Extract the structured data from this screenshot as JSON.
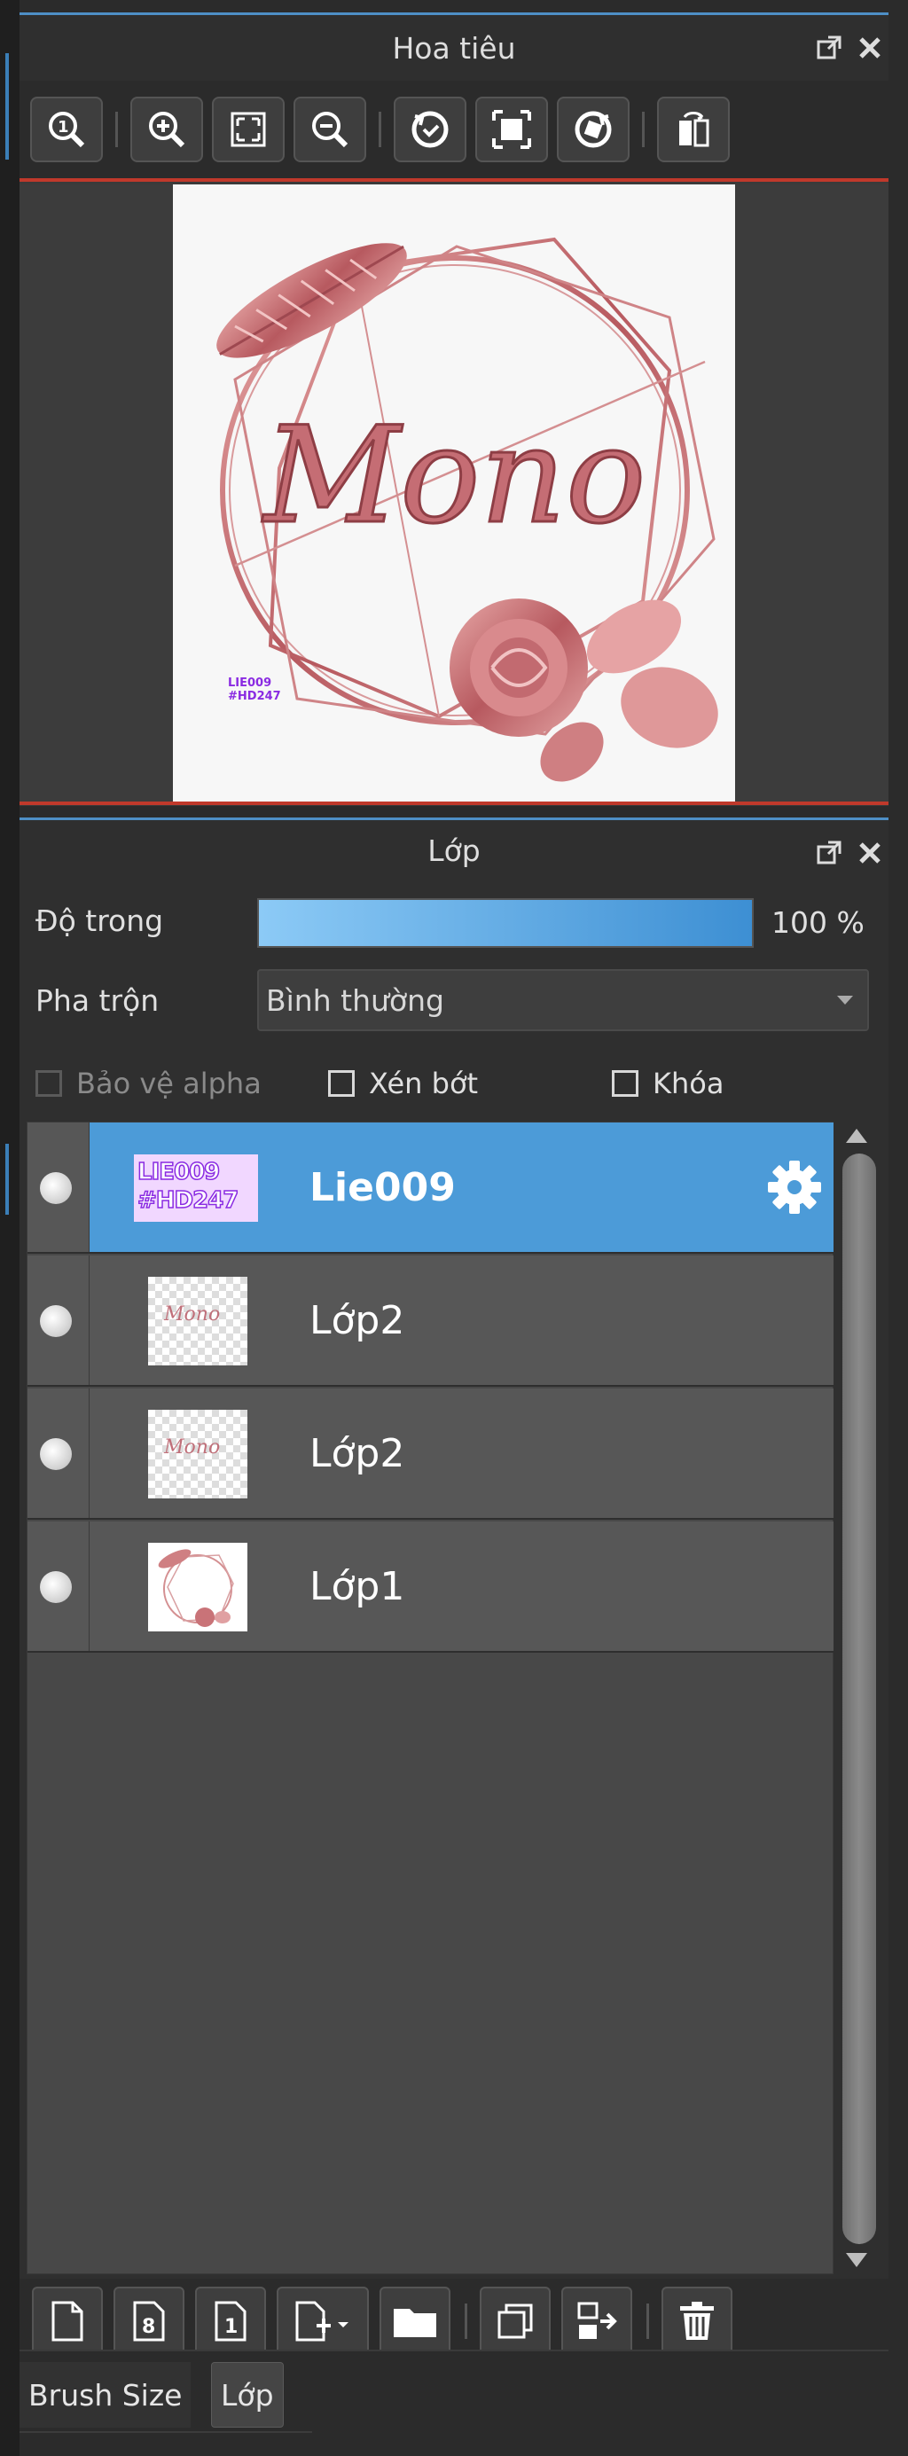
{
  "navigator": {
    "title": "Hoa tiêu",
    "toolbar": [
      "zoom-actual-icon",
      "zoom-in-icon",
      "fit-screen-icon",
      "zoom-out-icon",
      "rotate-left-icon",
      "fullscreen-icon",
      "rotate-right-icon",
      "flip-horizontal-icon"
    ],
    "preview": {
      "logo_text": "Mono",
      "watermark_line1": "LIE009",
      "watermark_line2": "#HD247"
    }
  },
  "layers_panel": {
    "title": "Lớp",
    "opacity_label": "Độ trong",
    "opacity_value": "100 %",
    "opacity_fraction": 1.0,
    "blend_label": "Pha trộn",
    "blend_value": "Bình thường",
    "protect_alpha_label": "Bảo vệ alpha",
    "clipping_label": "Xén bớt",
    "lock_label": "Khóa",
    "layers": [
      {
        "name": "Lie009",
        "thumb_text_1": "LIE009",
        "thumb_text_2": "#HD247",
        "selected": true
      },
      {
        "name": "Lớp2",
        "thumb_text": "Mono",
        "selected": false
      },
      {
        "name": "Lớp2",
        "thumb_text": "Mono",
        "selected": false
      },
      {
        "name": "Lớp1",
        "selected": false
      }
    ],
    "toolbar": [
      "new-layer-icon",
      "new-8bit-layer-icon",
      "new-1bit-layer-icon",
      "add-special-layer-icon",
      "new-folder-icon",
      "duplicate-layer-icon",
      "merge-down-icon",
      "delete-layer-icon"
    ]
  },
  "bottom_tabs": [
    "Brush Size",
    "Lớp"
  ],
  "colors": {
    "accent": "#4c9bd8",
    "panel_bg": "#2f2f2f",
    "rose_gold": "#c97a80",
    "watermark": "#8a2be2"
  }
}
